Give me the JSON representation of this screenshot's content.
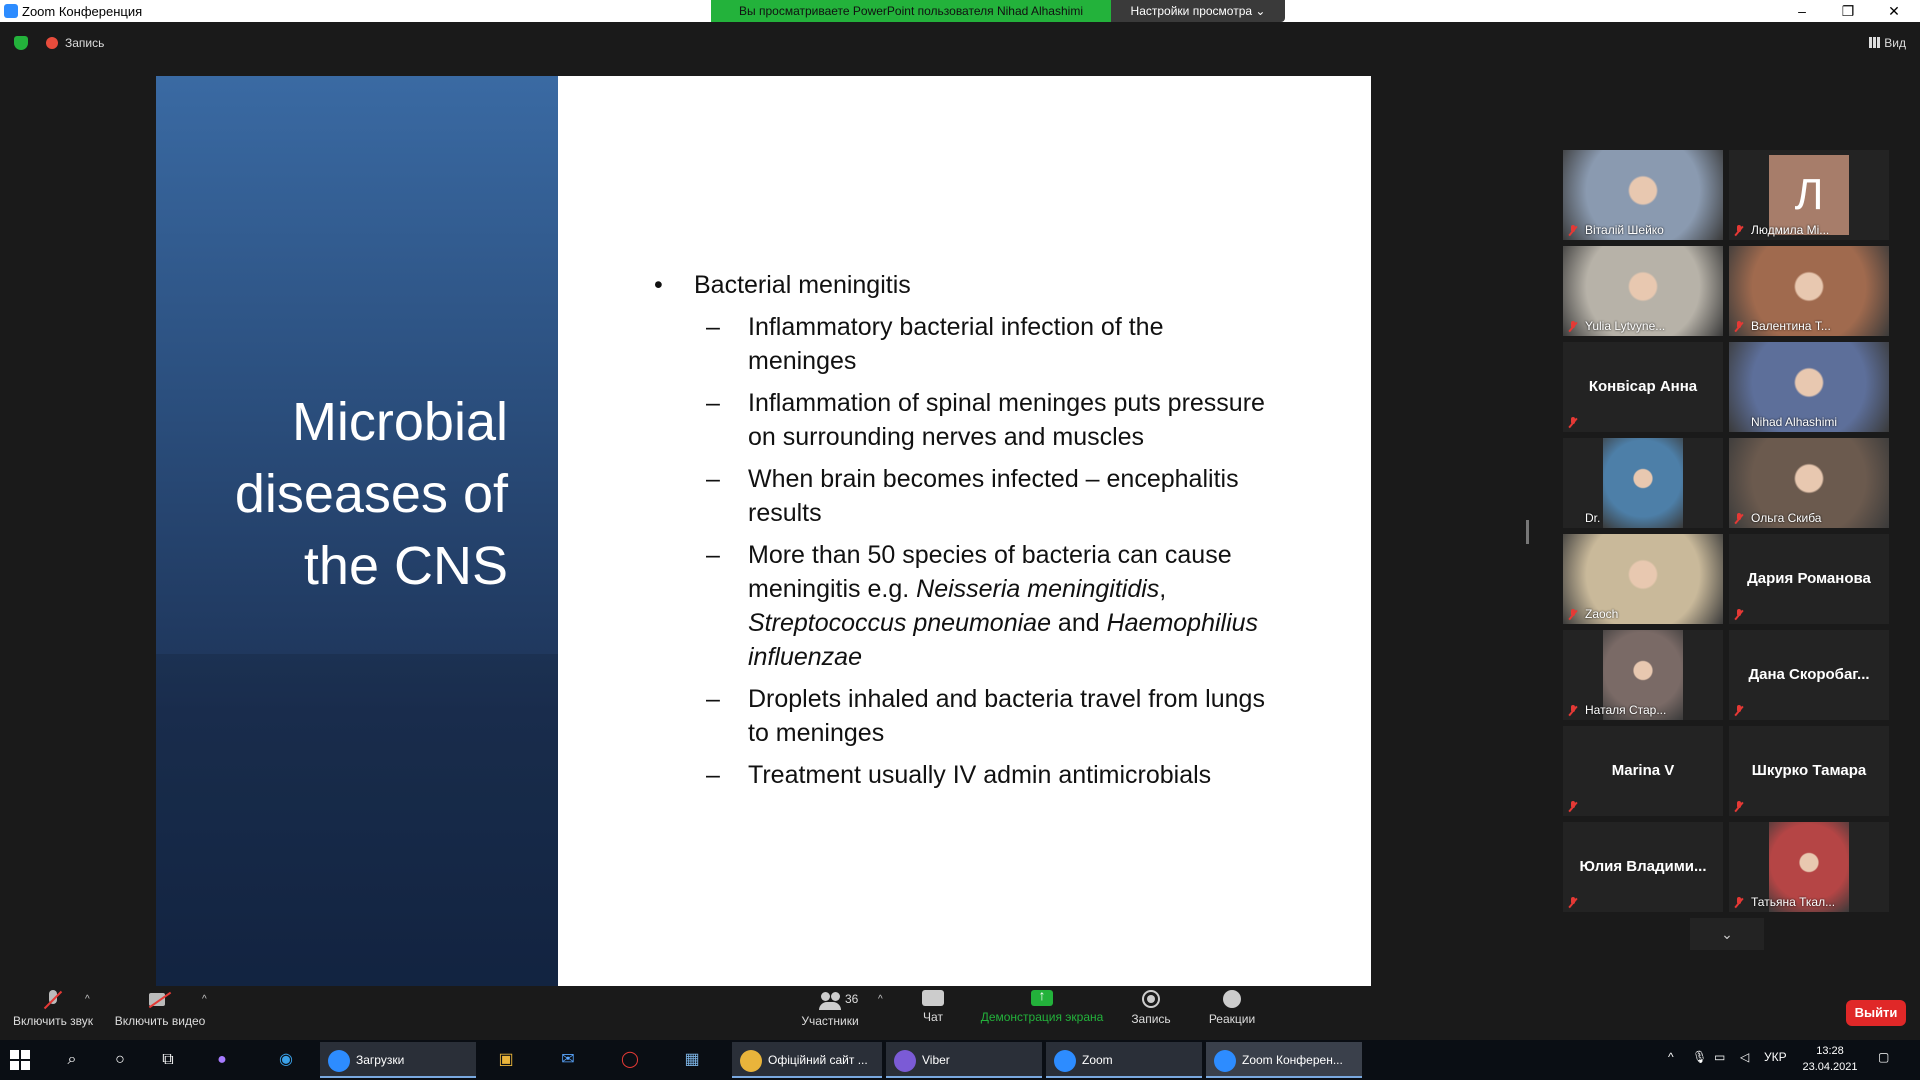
{
  "window": {
    "title": "Zoom Конференция",
    "share_banner": "Вы просматриваете PowerPoint пользователя Nihad Alhashimi",
    "view_settings": "Настройки просмотра ⌄",
    "buttons": {
      "minimize": "–",
      "maximize": "❐",
      "close": "✕"
    }
  },
  "topbar": {
    "recording_label": "Запись",
    "view_label": "Вид"
  },
  "slide": {
    "title_lines": [
      "Microbial",
      "diseases of",
      "the CNS"
    ],
    "bullet_main": "Bacterial meningitis",
    "subs": [
      "Inflammatory bacterial infection of the meninges",
      "Inflammation of spinal meninges puts pressure on surrounding nerves and muscles",
      "When brain becomes infected – encephalitis results"
    ],
    "sub4": {
      "text_a": "More than 50 species of bacteria can cause meningitis e.g. ",
      "italic_a": "Neisseria meningitidis",
      "text_b": ", ",
      "italic_b": "Streptococcus pneumoniae",
      "text_c": " and ",
      "italic_c": "Haemophilius influenzae"
    },
    "subs_tail": [
      "Droplets inhaled and bacteria travel from lungs to meninges",
      "Treatment usually IV admin antimicrobials"
    ]
  },
  "gallery": {
    "tiles": [
      {
        "name": "Віталій Шейко",
        "type": "video",
        "color": "#8a9ab0"
      },
      {
        "name": "Людмила Мі...",
        "type": "avatar",
        "letter": "Л"
      },
      {
        "name": "Yulia Lytvyne...",
        "type": "video",
        "color": "#b7b2a8"
      },
      {
        "name": "Валентина Т...",
        "type": "video",
        "color": "#a06a4e"
      },
      {
        "name": "Конвісар Анна",
        "type": "name"
      },
      {
        "name": "Nihad Alhashimi",
        "type": "video",
        "color": "#5d6f9a",
        "active": true
      },
      {
        "name": "Dr.",
        "type": "video-small",
        "color": "#4d7fa8"
      },
      {
        "name": "Ольга Скиба",
        "type": "video",
        "color": "#6b5a4e"
      },
      {
        "name": "Zaoch",
        "type": "video",
        "color": "#c9b99a"
      },
      {
        "name": "Дария Романова",
        "type": "name"
      },
      {
        "name": "Наталя Стар...",
        "type": "video-small",
        "color": "#7a6a66"
      },
      {
        "name": "Дана  Скоробаг...",
        "type": "name"
      },
      {
        "name": "Marina V",
        "type": "name"
      },
      {
        "name": "Шкурко Тамара",
        "type": "name"
      },
      {
        "name": "Юлия  Владими...",
        "type": "name"
      },
      {
        "name": "Татьяна Ткал...",
        "type": "video-small",
        "color": "#b54545"
      }
    ],
    "scroll_down": "⌄"
  },
  "toolbar": {
    "unmute": "Включить звук",
    "start_video": "Включить видео",
    "participants": "Участники",
    "participants_count": "36",
    "chat": "Чат",
    "share_screen": "Демонстрация экрана",
    "record": "Запись",
    "reactions": "Реакции",
    "leave": "Выйти",
    "caret": "^"
  },
  "taskbar": {
    "tasks": [
      {
        "label": "Загрузки",
        "color": "#2d8cff"
      },
      {
        "label": "Офіційний сайт ...",
        "color": "#e9b43b"
      },
      {
        "label": "Viber",
        "color": "#7b5bd6"
      },
      {
        "label": "Zoom",
        "color": "#2d8cff"
      },
      {
        "label": "Zoom Конферен...",
        "color": "#2d8cff"
      }
    ],
    "lang": "УКР",
    "time": "13:28",
    "date": "23.04.2021"
  },
  "colors": {
    "share_green": "#23b23b",
    "leave_red": "#e02828",
    "active_border": "#f2d600"
  }
}
